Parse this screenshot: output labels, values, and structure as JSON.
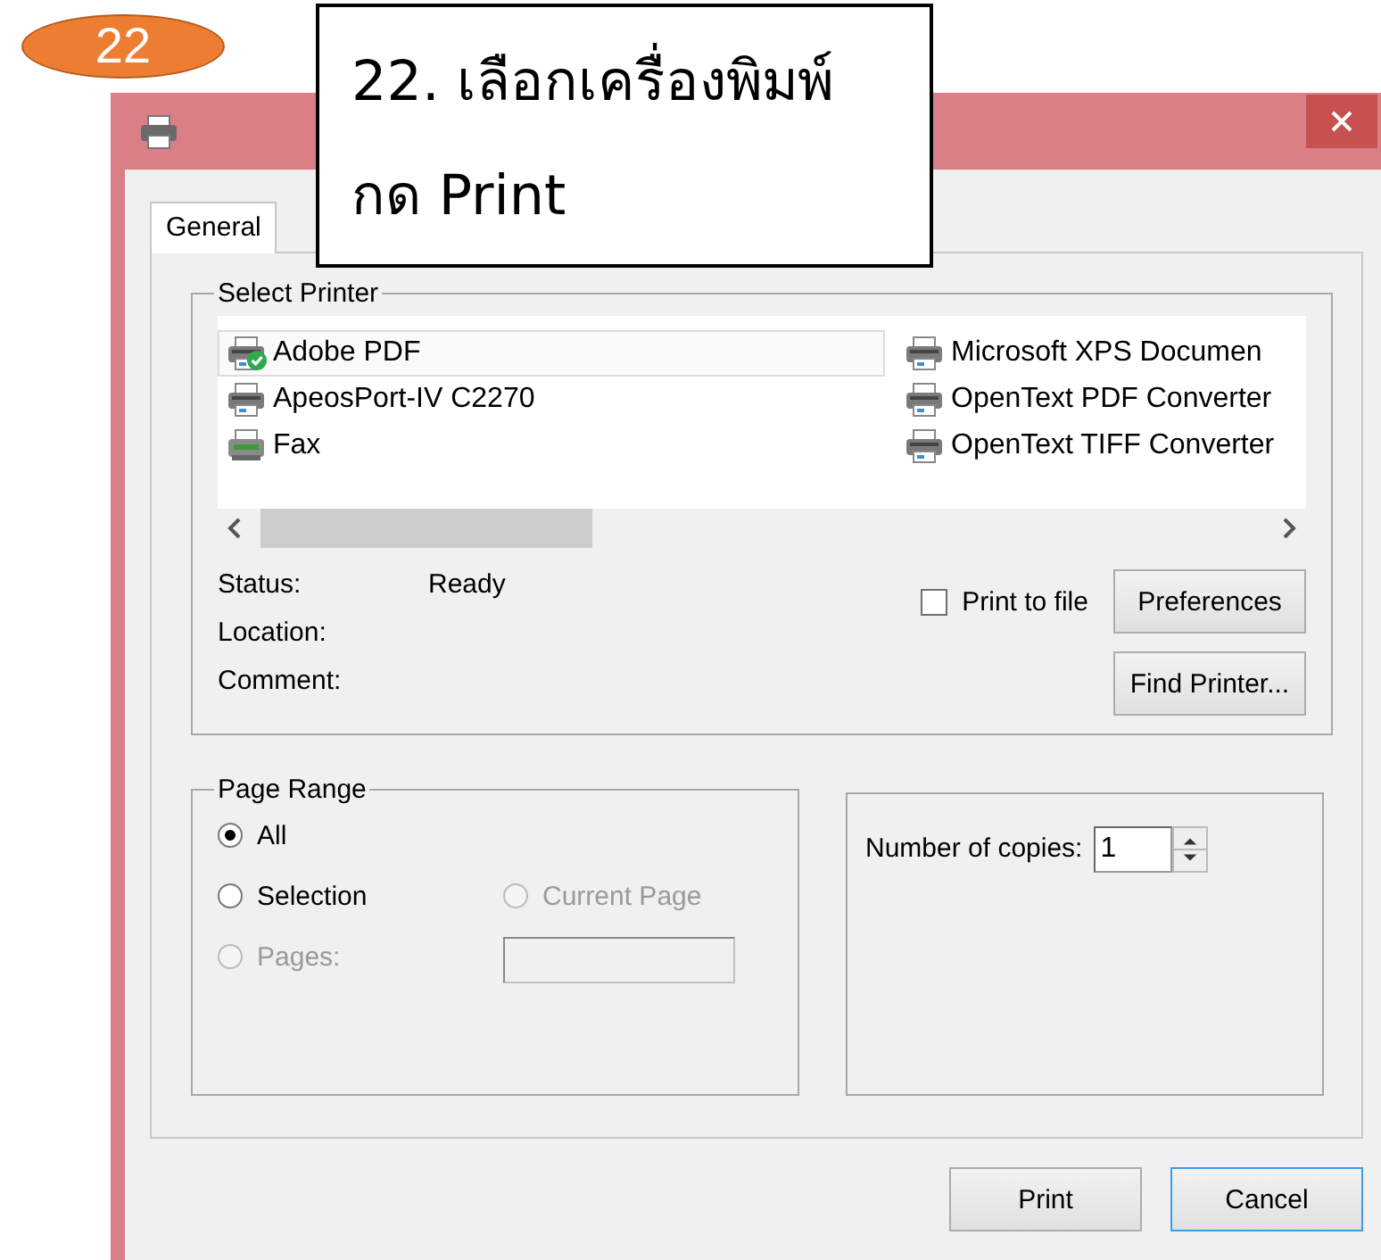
{
  "callout": {
    "badge": "22",
    "lines": [
      "22. เลือกเครื่องพิมพ์",
      "กด Print"
    ]
  },
  "tabs": [
    {
      "label": "General",
      "selected": true
    }
  ],
  "select_printer": {
    "legend": "Select Printer",
    "printers": [
      {
        "name": "Adobe PDF",
        "kind": "printer",
        "selected": true,
        "default": true
      },
      {
        "name": "ApeosPort-IV C2270",
        "kind": "printer",
        "selected": false,
        "default": false
      },
      {
        "name": "Fax",
        "kind": "fax",
        "selected": false,
        "default": false
      },
      {
        "name": "Microsoft XPS Documen",
        "kind": "printer",
        "selected": false,
        "default": false
      },
      {
        "name": "OpenText PDF Converter",
        "kind": "printer",
        "selected": false,
        "default": false
      },
      {
        "name": "OpenText TIFF Converter",
        "kind": "printer",
        "selected": false,
        "default": false
      }
    ],
    "info": [
      {
        "label": "Status:",
        "value": "Ready"
      },
      {
        "label": "Location:"
      },
      {
        "label": "Comment:"
      }
    ],
    "print_to_file": {
      "label": "Print to file",
      "checked": false
    },
    "buttons": [
      "Preferences",
      "Find Printer..."
    ]
  },
  "page_range": {
    "legend": "Page Range",
    "options": [
      {
        "label": "All",
        "selected": true,
        "disabled": false
      },
      {
        "label": "Selection",
        "selected": false,
        "disabled": false
      },
      {
        "label": "Current Page",
        "selected": false,
        "disabled": true
      },
      {
        "label": "Pages:",
        "selected": false,
        "disabled": true
      }
    ],
    "pages_field": {
      "disabled": true
    }
  },
  "copies": {
    "label": "Number of copies:",
    "value": "1"
  },
  "buttons": [
    {
      "label": "Print",
      "focused": false
    },
    {
      "label": "Cancel",
      "focused": true
    }
  ]
}
